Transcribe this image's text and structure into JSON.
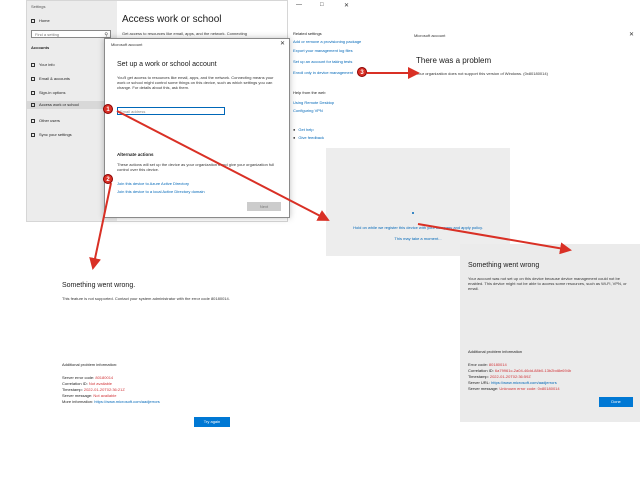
{
  "settings": {
    "window_title": "Settings",
    "home": "Home",
    "search_placeholder": "Find a setting",
    "section": "Accounts",
    "nav": [
      "Your info",
      "Email & accounts",
      "Sign-in options",
      "Access work or school",
      "Other users",
      "Sync your settings"
    ],
    "page_title": "Access work or school",
    "page_desc": "Get access to resources like email, apps, and the network. Connecting"
  },
  "related": {
    "heading": "Related settings",
    "links": [
      "Add or remove a provisioning package",
      "Export your management log files",
      "Set up an account for taking tests",
      "Enroll only in device management"
    ],
    "help_heading": "Help from the web",
    "help_links": [
      "Using Remote Desktop",
      "Configuring VPN"
    ],
    "get_help": "Get help",
    "feedback": "Give feedback"
  },
  "dialog": {
    "title": "Microsoft account",
    "heading": "Set up a work or school account",
    "desc": "You'll get access to resources like email, apps, and the network. Connecting means your work or school might control some things on this device, such as which settings you can change. For details about this, ask them.",
    "email_placeholder": "Email address",
    "alt_title": "Alternate actions",
    "alt_desc": "These actions will set up the device as your organization's and give your organization full control over this device.",
    "join_aad": "Join this device to Azure Active Directory",
    "join_ad": "Join this device to a local Active Directory domain",
    "next": "Next"
  },
  "problem": {
    "title": "Microsoft account",
    "heading": "There was a problem",
    "message": "Your organization does not support this version of Windows. (0x80180014)"
  },
  "registering": {
    "message": "Hold on while we register this device with your company and apply policy.",
    "wait": "This may take a moment..."
  },
  "error_left": {
    "title": "Something went wrong.",
    "desc": "This feature is not supported. Contact your system administrator with the error code 80180014.",
    "info_title": "Additional problem information:",
    "rows": [
      {
        "label": "Server error code: ",
        "value": "80180014"
      },
      {
        "label": "Correlation ID: ",
        "value": "Not available"
      },
      {
        "label": "Timestamp: ",
        "value": "2022-01-20T02:36:21Z"
      },
      {
        "label": "Server message: ",
        "value": "Not available"
      },
      {
        "label": "More information: ",
        "value": "https://www.microsoft.com/aadjerrors"
      }
    ],
    "try_again": "Try again"
  },
  "error_right": {
    "title": "Something went wrong",
    "desc": "Your account was not set up on this device because device management could not be enabled. This device might not be able to access some resources, such as Wi-Fi, VPN, or email.",
    "info_title": "Additional problem information",
    "rows": [
      {
        "label": "Error code: ",
        "value": "80180014"
      },
      {
        "label": "Correlation ID: ",
        "value": "6a79961c-2a04-46dd-88b0-13b2bd8e694b"
      },
      {
        "label": "Timestamp: ",
        "value": "2022-01-20T02:36:59Z"
      },
      {
        "label": "Server URL: ",
        "value": "https://www.microsoft.com/aadjerrors"
      },
      {
        "label": "Server message: ",
        "value": "Unknown error code: 0x80180014"
      }
    ],
    "done": "Done"
  },
  "badges": [
    "1",
    "2",
    "3"
  ],
  "colors": {
    "accent": "#0078d4",
    "link": "#0067b8",
    "error": "#d13438",
    "callout": "#d93025"
  }
}
